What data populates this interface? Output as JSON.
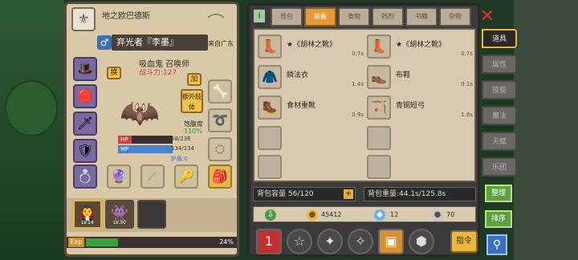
{
  "character": {
    "title": "地之欧巴德斯",
    "gender_icon": "♂",
    "name": "弃光者『李墨』",
    "origin": "来自广东",
    "class": "吸血鬼 召唤师",
    "power": "战斗力:127",
    "exchange_btn": "换",
    "add_btn": "加",
    "extra_limb_btn": "额外肢体",
    "satiety_label": "饱腹度",
    "satiety_value": "110%",
    "hp_label": "HP",
    "hp_value": "58/236",
    "hp_fraction": 0.25,
    "mp_label": "MP",
    "mp_value": "134/134",
    "mp_fraction": 1.0,
    "shield": "护盾:0",
    "party": [
      {
        "level": "LV.14",
        "icon": "🧛",
        "selected": true
      },
      {
        "level": "LV.30",
        "icon": "👾",
        "selected": false
      },
      {
        "level": "",
        "icon": "",
        "selected": false
      }
    ],
    "exp_label": "Exp",
    "exp_value": "24%",
    "exp_fraction": 0.24
  },
  "inventory": {
    "info_icon": "i",
    "tabs": [
      "背包",
      "装备",
      "食物",
      "药剂",
      "书籍",
      "杂物"
    ],
    "active_tab": "装备",
    "items": [
      {
        "name": "★《胡林之靴》",
        "time": "0.7s",
        "icon": "boot-icon"
      },
      {
        "name": "★《胡林之靴》",
        "time": "0.7s",
        "icon": "boot-icon"
      },
      {
        "name": "鳞法衣",
        "time": "1.4s",
        "icon": "robe-icon"
      },
      {
        "name": "布鞋",
        "time": "0.1s",
        "icon": "shoe-icon"
      },
      {
        "name": "食材重靴",
        "time": "0.9s",
        "icon": "boot-icon"
      },
      {
        "name": "青铜短弓",
        "time": "1.6s",
        "icon": "bow-icon"
      }
    ],
    "capacity": "背包容量 56/120",
    "capacity_plus": "+",
    "weight": "背包重量:44.1s/125.8s",
    "gold": "45412",
    "gems": "12",
    "silver": "70",
    "command_btn": "指令"
  },
  "side_tabs": [
    "道具",
    "属性",
    "技能",
    "魔法",
    "天赋",
    "乐团"
  ],
  "active_side_tab": "道具",
  "actions": {
    "organize": "整理",
    "sort": "排序"
  }
}
